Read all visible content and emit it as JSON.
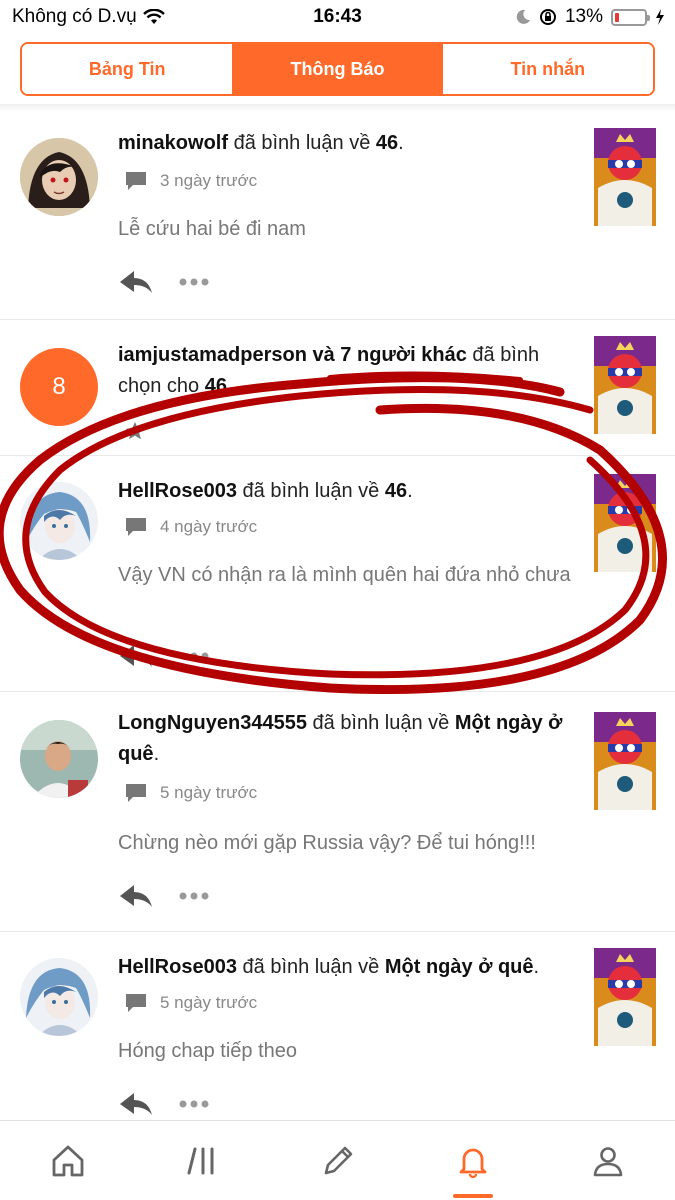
{
  "status_bar": {
    "carrier": "Không có D.vụ",
    "time": "16:43",
    "battery": "13%",
    "battery_level": 0.13
  },
  "tabs": [
    {
      "label": "Bảng Tin",
      "active": false
    },
    {
      "label": "Thông Báo",
      "active": true
    },
    {
      "label": "Tin nhắn",
      "active": false
    }
  ],
  "notifications": [
    {
      "user": "minakowolf",
      "action": " đã bình luận về ",
      "target": "46",
      "suffix": ".",
      "time": "3 ngày trước",
      "comment": "Lễ cứu hai bé đi nam"
    },
    {
      "user": "iamjustamadperson và 7 người khác",
      "action": " đã bình chọn cho ",
      "target": "46",
      "suffix": ".",
      "count_badge": "8"
    },
    {
      "user": "HellRose003",
      "action": " đã bình luận về ",
      "target": "46",
      "suffix": ".",
      "time": "4 ngày trước",
      "comment": "Vậy VN có nhận ra là mình quên hai đứa nhỏ chưa"
    },
    {
      "user": "LongNguyen344555",
      "action": " đã bình luận về ",
      "target": "Một ngày ở quê",
      "suffix": ".",
      "time": "5 ngày trước",
      "comment": "Chừng nèo mới gặp Russia vậy? Để tui hóng!!!"
    },
    {
      "user": "HellRose003",
      "action": " đã bình luận về ",
      "target": "Một ngày ở quê",
      "suffix": ".",
      "time": "5 ngày trước",
      "comment": "Hóng chap tiếp theo"
    }
  ],
  "bottom_nav": [
    {
      "icon": "home-icon",
      "active": false
    },
    {
      "icon": "library-icon",
      "active": false
    },
    {
      "icon": "pencil-icon",
      "active": false
    },
    {
      "icon": "bell-icon",
      "active": true
    },
    {
      "icon": "profile-icon",
      "active": false
    }
  ],
  "colors": {
    "accent": "#ff6a2b",
    "annotation_red": "#b30000",
    "muted_text": "#888888"
  }
}
